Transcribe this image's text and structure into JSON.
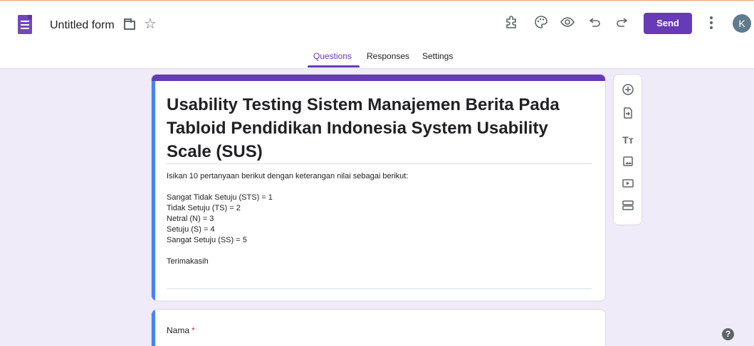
{
  "header": {
    "doc_title": "Untitled form",
    "send_label": "Send",
    "avatar_letter": "K"
  },
  "tabs": [
    {
      "label": "Questions",
      "active": true
    },
    {
      "label": "Responses",
      "active": false
    },
    {
      "label": "Settings",
      "active": false
    }
  ],
  "form": {
    "title": "Usability Testing Sistem Manajemen Berita Pada Tabloid Pendidikan Indonesia System Usability Scale (SUS)",
    "description_lines": [
      "Isikan 10 pertanyaan berikut dengan keterangan nilai sebagai berikut:",
      "",
      "Sangat Tidak Setuju (STS) = 1",
      "Tidak Setuju (TS) = 2",
      "Netral (N) = 3",
      "Setuju (S) = 4",
      "Sangat Setuju (SS) = 5",
      "",
      "Terimakasih"
    ]
  },
  "question": {
    "label": "Nama",
    "required_mark": "*"
  },
  "toolbar_icons": [
    "add-question-icon",
    "import-questions-icon",
    "add-title-icon",
    "add-image-icon",
    "add-video-icon",
    "add-section-icon"
  ],
  "top_icons": [
    "addons-icon",
    "palette-icon",
    "preview-icon",
    "undo-icon",
    "redo-icon"
  ],
  "colors": {
    "accent": "#673ab7",
    "background": "#f0ebf8",
    "focus_stripe": "#4285f4",
    "required": "#d93025"
  }
}
